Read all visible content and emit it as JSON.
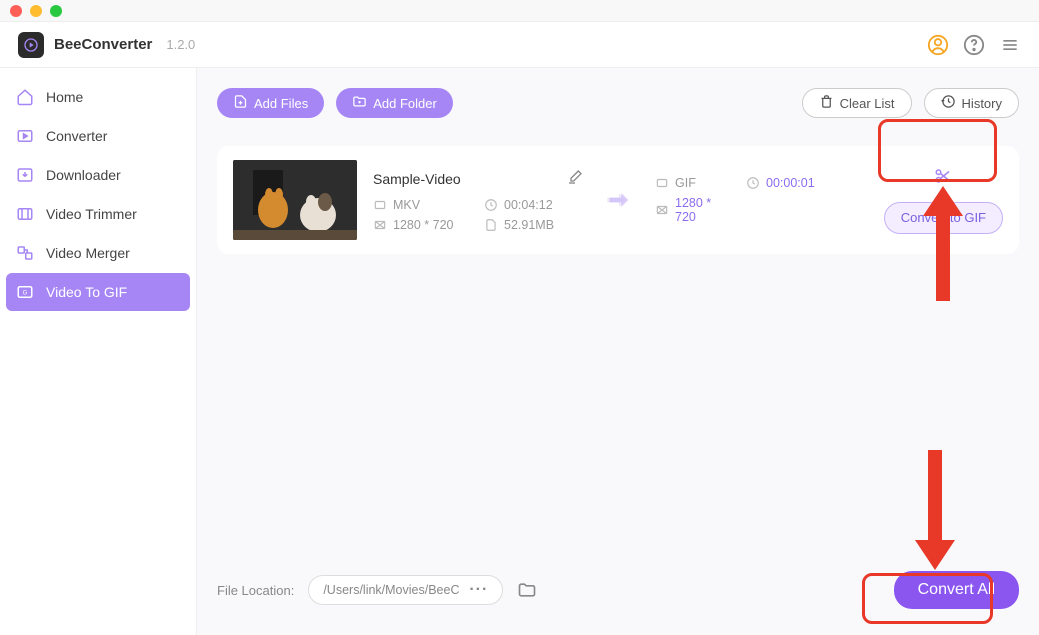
{
  "app": {
    "name": "BeeConverter",
    "version": "1.2.0"
  },
  "sidebar": {
    "items": [
      {
        "label": "Home"
      },
      {
        "label": "Converter"
      },
      {
        "label": "Downloader"
      },
      {
        "label": "Video Trimmer"
      },
      {
        "label": "Video Merger"
      },
      {
        "label": "Video To GIF"
      }
    ]
  },
  "toolbar": {
    "add_files": "Add Files",
    "add_folder": "Add Folder",
    "clear_list": "Clear List",
    "history": "History"
  },
  "item": {
    "name": "Sample-Video",
    "src": {
      "format": "MKV",
      "duration": "00:04:12",
      "resolution": "1280 * 720",
      "size": "52.91MB"
    },
    "dst": {
      "format": "GIF",
      "duration": "00:00:01",
      "resolution": "1280 * 720"
    },
    "convert_label": "Convert to GIF"
  },
  "footer": {
    "location_label": "File Location:",
    "path": "/Users/link/Movies/BeeC",
    "convert_all": "Convert All"
  }
}
